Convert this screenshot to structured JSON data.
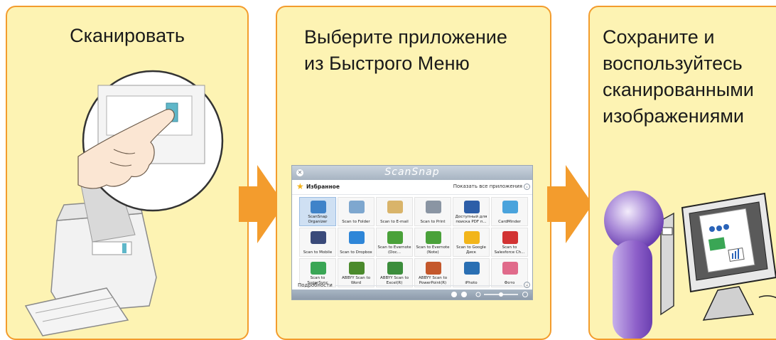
{
  "panels": [
    {
      "title": "Сканировать"
    },
    {
      "title_lines": [
        "Выберите приложение",
        "из Быстрого Меню"
      ]
    },
    {
      "title_lines": [
        "Сохраните и",
        "воспользуйтесь",
        "сканированными",
        "изображениями"
      ]
    }
  ],
  "colors": {
    "panel_bg": "#fdf3b3",
    "panel_border": "#f39c2d",
    "arrow": "#f39c2d",
    "person": "#8d5fc9",
    "scansnap_titlebar": "#a7b4c2",
    "selected_tile": "#cfe0f3"
  },
  "scansnap": {
    "brand": "ScanSnap",
    "favorites_label": "Избранное",
    "show_all_label": "Показать все приложения",
    "details_label": "Подробности",
    "apps": [
      {
        "label": "ScanSnap Organizer",
        "icon": "folder-icon",
        "color": "#3f83c9",
        "selected": true
      },
      {
        "label": "Scan to Folder",
        "icon": "folder-icon",
        "color": "#7ea7cf"
      },
      {
        "label": "Scan to E-mail",
        "icon": "envelope-icon",
        "color": "#d9b46a"
      },
      {
        "label": "Scan to Print",
        "icon": "printer-icon",
        "color": "#8a95a3"
      },
      {
        "label": "Доступный для поиска PDF п...",
        "icon": "searchable-pdf-icon",
        "color": "#2d5ea8"
      },
      {
        "label": "CardMinder",
        "icon": "card-icon",
        "color": "#4aa3dc"
      },
      {
        "label": "Scan to Mobile",
        "icon": "mobile-icon",
        "color": "#3a4a7a"
      },
      {
        "label": "Scan to Dropbox",
        "icon": "dropbox-icon",
        "color": "#2e86d8"
      },
      {
        "label": "Scan to Evernote (Doc...",
        "icon": "evernote-icon",
        "color": "#4aa13a"
      },
      {
        "label": "Scan to Evernote (Note)",
        "icon": "evernote-icon",
        "color": "#4aa13a"
      },
      {
        "label": "Scan to Google Диск",
        "icon": "google-drive-icon",
        "color": "#f2b51b"
      },
      {
        "label": "Scan to Salesforce Ch...",
        "icon": "salesforce-icon",
        "color": "#d23333"
      },
      {
        "label": "Scan to SugarSync",
        "icon": "sugarsync-icon",
        "color": "#3aa655"
      },
      {
        "label": "ABBYY Scan to Word",
        "icon": "abbyy-word-icon",
        "color": "#4b8a2c"
      },
      {
        "label": "ABBYY Scan to Excel(R)",
        "icon": "abbyy-excel-icon",
        "color": "#3c8d3c"
      },
      {
        "label": "ABBYY Scan to PowerPoint(R)",
        "icon": "abbyy-powerpoint-icon",
        "color": "#c4582c"
      },
      {
        "label": "iPhoto",
        "icon": "iphoto-icon",
        "color": "#2a6fb3"
      },
      {
        "label": "Фото",
        "icon": "photos-icon",
        "color": "#e06a8a"
      }
    ]
  }
}
